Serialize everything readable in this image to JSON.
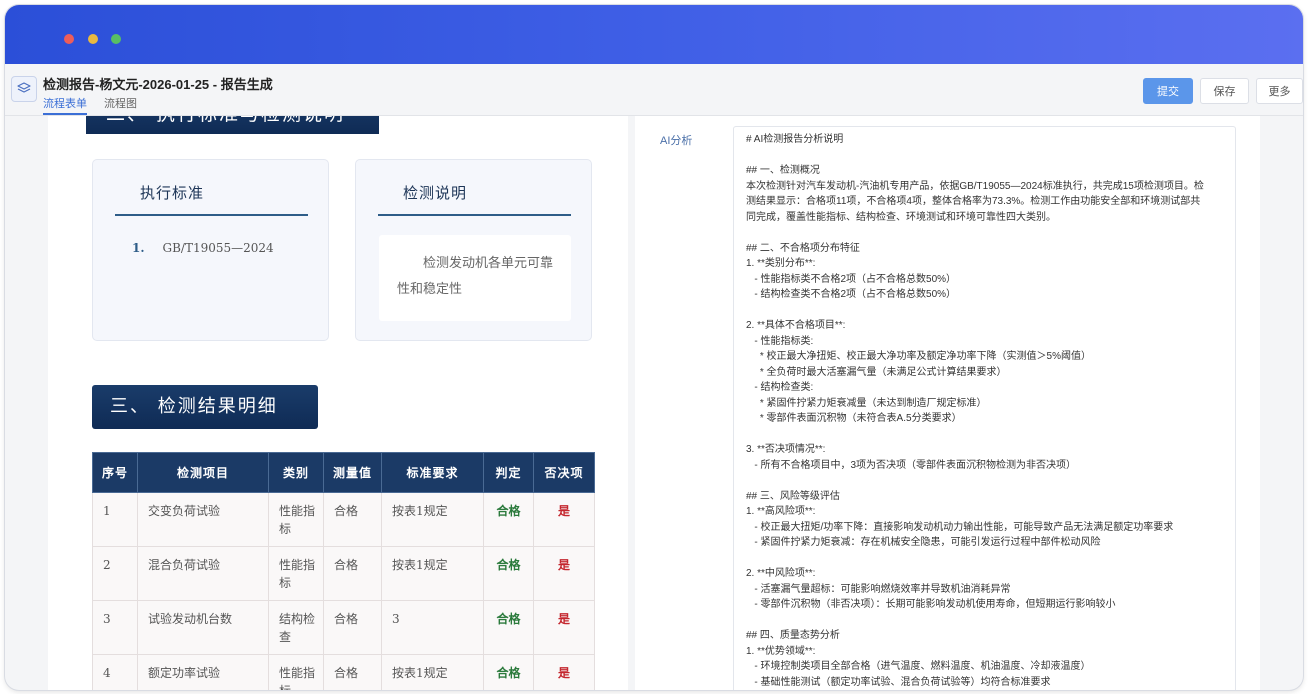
{
  "window": {
    "title": "检测报告-杨文元-2026-01-25 - 报告生成",
    "tabs": [
      {
        "label": "流程表单",
        "active": true
      },
      {
        "label": "流程图",
        "active": false
      }
    ],
    "actions": {
      "submit": "提交",
      "save": "保存",
      "more": "更多"
    }
  },
  "report": {
    "section2_title": "二、  执行标准与检测说明",
    "standard_card": {
      "title": "执行标准",
      "items": [
        {
          "num": "1.",
          "text": "GB/T19055—2024"
        }
      ]
    },
    "description_card": {
      "title": "检测说明",
      "text": "检测发动机各单元可靠性和稳定性"
    },
    "section3_title": "三、  检测结果明细",
    "table": {
      "headers": [
        "序号",
        "检测项目",
        "类别",
        "测量值",
        "标准要求",
        "判定",
        "否决项"
      ],
      "rows": [
        [
          "1",
          "交变负荷试验",
          "性能指标",
          "合格",
          "按表1规定",
          "合格",
          "是"
        ],
        [
          "2",
          "混合负荷试验",
          "性能指标",
          "合格",
          "按表1规定",
          "合格",
          "是"
        ],
        [
          "3",
          "试验发动机台数",
          "结构检查",
          "合格",
          "3",
          "合格",
          "是"
        ],
        [
          "4",
          "额定功率试验",
          "性能指标",
          "合格",
          "按表1规定",
          "合格",
          "是"
        ]
      ]
    }
  },
  "analysis": {
    "label": "AI分析",
    "lines": [
      "# AI检测报告分析说明",
      "",
      "## 一、检测概况",
      "本次检测针对汽车发动机-汽油机专用产品，依据GB/T19055—2024标准执行，共完成15项检测项目。检",
      "测结果显示：合格项11项，不合格项4项，整体合格率为73.3%。检测工作由功能安全部和环境测试部共",
      "同完成，覆盖性能指标、结构检查、环境测试和环境可靠性四大类别。",
      "",
      "## 二、不合格项分布特征",
      "1. **类别分布**:",
      "   - 性能指标类不合格2项（占不合格总数50%）",
      "   - 结构检查类不合格2项（占不合格总数50%）",
      "",
      "2. **具体不合格项目**:",
      "   - 性能指标类:",
      "     * 校正最大净扭矩、校正最大净功率及额定净功率下降（实测值＞5%阈值）",
      "     * 全负荷时最大活塞漏气量（未满足公式计算结果要求）",
      "   - 结构检查类:",
      "     * 紧固件拧紧力矩衰减量（未达到制造厂规定标准）",
      "     * 零部件表面沉积物（未符合表A.5分类要求）",
      "",
      "3. **否决项情况**:",
      "   - 所有不合格项目中，3项为否决项（零部件表面沉积物检测为非否决项）",
      "",
      "## 三、风险等级评估",
      "1. **高风险项**:",
      "   - 校正最大扭矩/功率下降：直接影响发动机动力输出性能，可能导致产品无法满足额定功率要求",
      "   - 紧固件拧紧力矩衰减：存在机械安全隐患，可能引发运行过程中部件松动风险",
      "",
      "2. **中风险项**:",
      "   - 活塞漏气量超标：可能影响燃烧效率并导致机油消耗异常",
      "   - 零部件沉积物（非否决项）：长期可能影响发动机使用寿命，但短期运行影响较小",
      "",
      "## 四、质量态势分析",
      "1. **优势领域**:",
      "   - 环境控制类项目全部合格（进气温度、燃料温度、机油温度、冷却液温度）",
      "   - 基础性能测试（额定功率试验、混合负荷试验等）均符合标准要求"
    ]
  }
}
